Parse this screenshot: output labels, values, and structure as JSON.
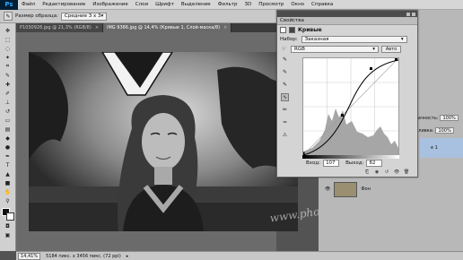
{
  "menubar": {
    "logo": "Ps",
    "items": [
      "Файл",
      "Редактирование",
      "Изображение",
      "Слои",
      "Шрифт",
      "Выделение",
      "Фильтр",
      "3D",
      "Просмотр",
      "Окно",
      "Справка"
    ]
  },
  "options": {
    "sample_label": "Размер образца:",
    "sample_value": "Средние 3 х 3"
  },
  "tabs": [
    {
      "label": "P1030926.jpg @ 21,3% (RGB/8)",
      "close": "×"
    },
    {
      "label": "IMG 9366.jpg @ 14,4% (Кривые 1, Слой-маска/8)",
      "close": "×"
    }
  ],
  "properties": {
    "tab_label": "Свойства",
    "header_label": "Кривые",
    "preset_label": "Набор:",
    "preset_value": "Заказная",
    "channel_value": "RGB",
    "auto_label": "Авто",
    "input_label": "Вход:",
    "input_value": "107",
    "output_label": "Выход:",
    "output_value": "82"
  },
  "right_panel": {
    "opacity_label": "зрачность:",
    "opacity_value": "100%",
    "fill_label": "Заливка:",
    "fill_value": "100%",
    "curves_layer_label": "е 1",
    "bg_layer_label": "Фон"
  },
  "status": {
    "zoom": "14,41%",
    "doc_info": "5184 пикс. x 3456 пикс. (72 ppi)"
  },
  "watermark": "www.photoshopsunduchok.ru",
  "colors": {
    "menubar_bg": "#d6d6d6",
    "canvas_bg": "#6b6b6b",
    "panel_bg": "#d4d4d4",
    "curve_color": "#000000"
  }
}
